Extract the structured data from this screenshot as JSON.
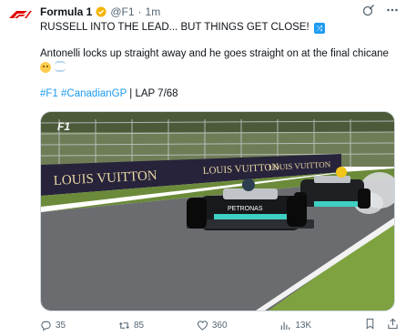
{
  "account": {
    "name": "Formula 1",
    "handle": "@F1",
    "time": "1m"
  },
  "post": {
    "line1": "RUSSELL INTO THE LEAD... BUT THINGS GET CLOSE!",
    "line2": "Antonelli locks up straight away and he goes straight on at the final chicane",
    "hashtag1": "#F1",
    "hashtag2": "#CanadianGP",
    "lap_text": " | LAP 7/68"
  },
  "media": {
    "banner_text_1": "LOUIS VUITTON",
    "banner_text_2": "LOUIS VUITTON",
    "banner_text_3": "LOUIS VUITTON",
    "banner_text_4": "LOUIS VUITTON",
    "car_text": "PETRONAS",
    "logo_text": "F1"
  },
  "actions": {
    "replies": "35",
    "reposts": "85",
    "likes": "360",
    "views": "13K"
  },
  "icons": {
    "grok": "grok-icon",
    "more": "more-icon",
    "verified": "verified-badge-icon",
    "shuffle": "shuffle-emoji-icon"
  },
  "colors": {
    "brand": "#e10600",
    "accent": "#1d9bf0",
    "verified": "#f4b400",
    "muted": "#536471"
  }
}
